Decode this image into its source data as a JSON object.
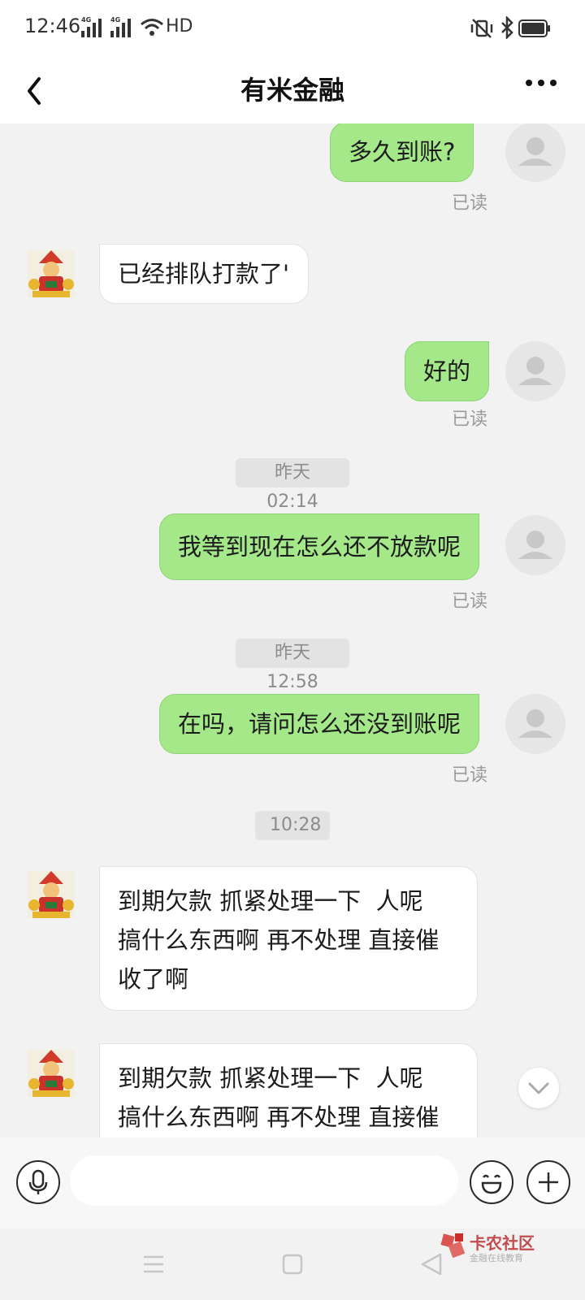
{
  "status_bar": {
    "time": "12:46",
    "signal_1": "4G",
    "signal_2": "4G",
    "hd": "HD"
  },
  "header": {
    "title": "有米金融"
  },
  "chat": {
    "messages": [
      {
        "text": "多久到账?",
        "read_status": "已读"
      },
      {
        "text": "已经排队打款了'"
      },
      {
        "text": "好的",
        "read_status": "已读"
      },
      {
        "timestamp": "昨天 02:14"
      },
      {
        "text": "我等到现在怎么还不放款呢",
        "read_status": "已读"
      },
      {
        "timestamp": "昨天 12:58"
      },
      {
        "text": "在吗，请问怎么还没到账呢",
        "read_status": "已读"
      },
      {
        "timestamp": "10:28"
      },
      {
        "lines": [
          "到期欠款 抓紧处理一下  人呢",
          "搞什么东西啊 再不处理 直接催",
          "收了啊"
        ]
      },
      {
        "lines": [
          "到期欠款 抓紧处理一下  人呢",
          "搞什么东西啊 再不处理 直接催"
        ]
      }
    ]
  },
  "input": {
    "placeholder": ""
  },
  "watermark": {
    "text": "卡农社区",
    "sub": "金融在线教育"
  },
  "colors": {
    "outgoing_bubble": "#a5e88a",
    "incoming_bubble": "#ffffff",
    "background": "#f2f2f2"
  }
}
